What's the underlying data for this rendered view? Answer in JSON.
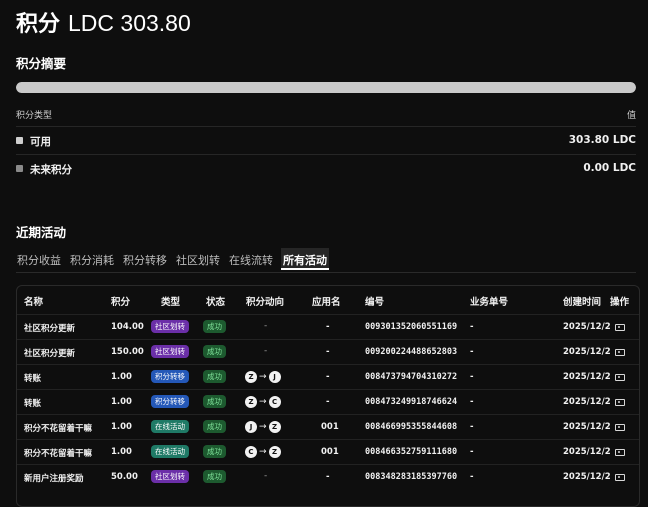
{
  "header": {
    "title": "积分",
    "amount": "LDC 303.80"
  },
  "summary": {
    "title": "积分摘要",
    "progress_fraction": 1.0,
    "col_type": "积分类型",
    "col_value": "值",
    "rows": [
      {
        "label": "可用",
        "value": "303.80 LDC",
        "color": "#cfcfcf"
      },
      {
        "label": "未来积分",
        "value": "0.00 LDC",
        "color": "#8a8a8a"
      }
    ]
  },
  "recent": {
    "title": "近期活动",
    "tabs": [
      "积分收益",
      "积分消耗",
      "积分转移",
      "社区划转",
      "在线流转",
      "所有活动"
    ],
    "active_tab": 5,
    "columns": [
      "名称",
      "积分",
      "类型",
      "状态",
      "积分动向",
      "应用名",
      "编号",
      "业务单号",
      "创建时间",
      "操作"
    ],
    "rows": [
      {
        "name": "社区积分更新",
        "points": "104.00",
        "type": "社区划转",
        "type_color": "purple",
        "status": "成功",
        "flow": "-",
        "app": "-",
        "id": "009301352060551169",
        "biz": "-",
        "time": "2025/12/2"
      },
      {
        "name": "社区积分更新",
        "points": "150.00",
        "type": "社区划转",
        "type_color": "purple",
        "status": "成功",
        "flow": "-",
        "app": "-",
        "id": "009200224488652803",
        "biz": "-",
        "time": "2025/12/2"
      },
      {
        "name": "转账",
        "points": "1.00",
        "type": "积分转移",
        "type_color": "blue",
        "status": "成功",
        "flow": [
          "Z",
          "J"
        ],
        "app": "-",
        "id": "008473794704310272",
        "biz": "-",
        "time": "2025/12/2"
      },
      {
        "name": "转账",
        "points": "1.00",
        "type": "积分转移",
        "type_color": "blue",
        "status": "成功",
        "flow": [
          "Z",
          "C"
        ],
        "app": "-",
        "id": "008473249918746624",
        "biz": "-",
        "time": "2025/12/2"
      },
      {
        "name": "积分不花留着干嘛",
        "points": "1.00",
        "type": "在线活动",
        "type_color": "teal",
        "status": "成功",
        "flow": [
          "J",
          "Z"
        ],
        "app": "001",
        "id": "008466995355844608",
        "biz": "-",
        "time": "2025/12/2"
      },
      {
        "name": "积分不花留着干嘛",
        "points": "1.00",
        "type": "在线活动",
        "type_color": "teal",
        "status": "成功",
        "flow": [
          "C",
          "Z"
        ],
        "app": "001",
        "id": "008466352759111680",
        "biz": "-",
        "time": "2025/12/2"
      },
      {
        "name": "新用户注册奖励",
        "points": "50.00",
        "type": "社区划转",
        "type_color": "purple",
        "status": "成功",
        "flow": "-",
        "app": "-",
        "id": "008348283185397760",
        "biz": "-",
        "time": "2025/12/2"
      }
    ]
  }
}
